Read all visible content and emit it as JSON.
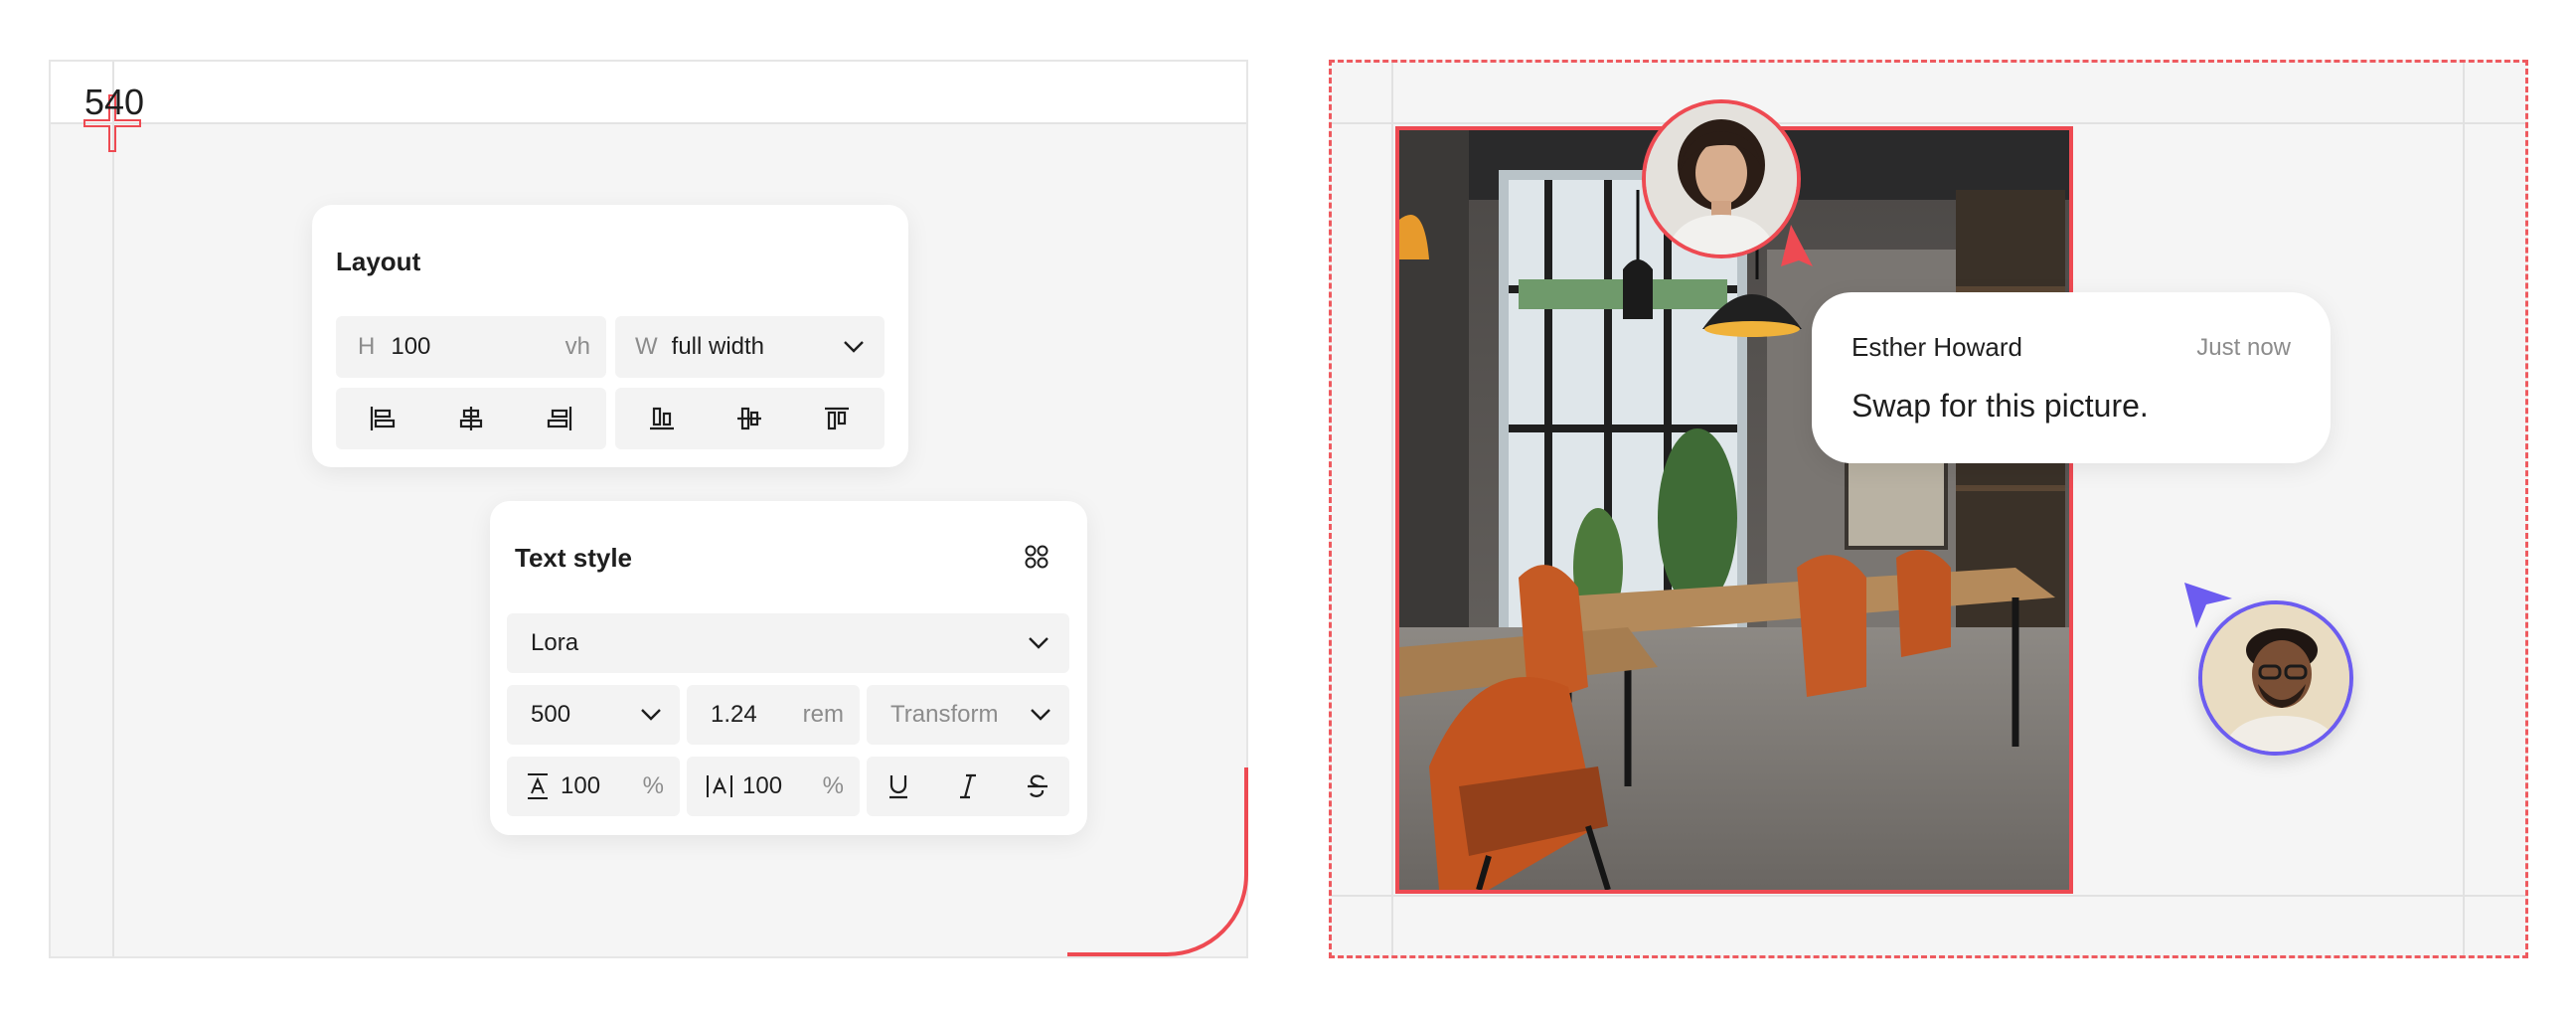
{
  "left_canvas": {
    "size_label": "540",
    "layout_panel": {
      "title": "Layout",
      "height_prefix": "H",
      "height_value": "100",
      "height_unit": "vh",
      "width_prefix": "W",
      "width_value": "full width",
      "icons": [
        "align-left-icon",
        "align-center-horizontal-icon",
        "align-right-icon",
        "align-bottom-icon",
        "align-center-vertical-icon",
        "align-top-icon"
      ]
    },
    "text_panel": {
      "title": "Text style",
      "font_family": "Lora",
      "font_weight": "500",
      "font_size": "1.24",
      "font_size_unit": "rem",
      "transform_placeholder": "Transform",
      "line_height_value": "100",
      "line_height_unit": "%",
      "letter_spacing_value": "100",
      "letter_spacing_unit": "%",
      "icons": [
        "line-height-icon",
        "letter-spacing-icon",
        "underline-icon",
        "italic-icon",
        "strikethrough-icon",
        "component-grid-icon"
      ]
    }
  },
  "right_canvas": {
    "comment": {
      "author": "Esther Howard",
      "time": "Just now",
      "message": "Swap for this picture."
    },
    "colors": {
      "accent_red": "#ee4a52",
      "accent_purple": "#6c5cf0"
    }
  }
}
